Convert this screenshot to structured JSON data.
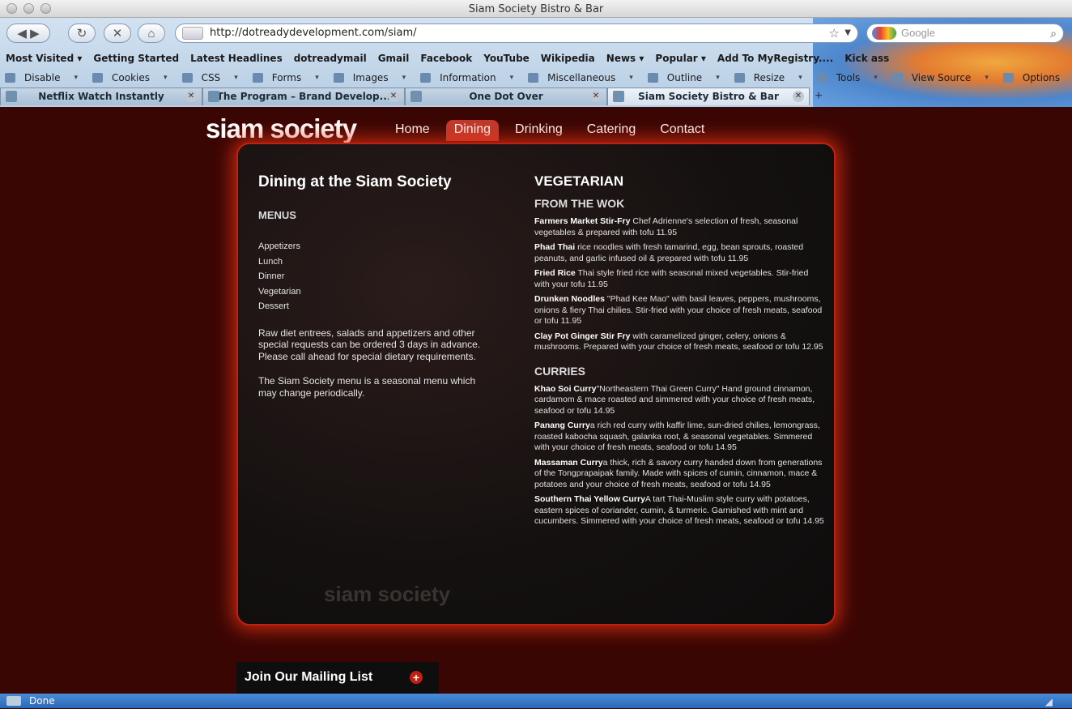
{
  "window": {
    "title": "Siam Society Bistro & Bar"
  },
  "navbar": {
    "url": "http://dotreadydevelopment.com/siam/",
    "search_placeholder": "Google"
  },
  "bookmarks": [
    "Most Visited ▾",
    "Getting Started",
    "Latest Headlines",
    "dotreadymail",
    "Gmail",
    "Facebook",
    "YouTube",
    "Wikipedia",
    "News ▾",
    "Popular ▾",
    "Add To MyRegistry....",
    "Kick ass"
  ],
  "devbar": [
    "Disable",
    "Cookies",
    "CSS",
    "Forms",
    "Images",
    "Information",
    "Miscellaneous",
    "Outline",
    "Resize",
    "Tools",
    "View Source",
    "Options"
  ],
  "tabs": [
    {
      "label": "Netflix Watch Instantly",
      "active": false
    },
    {
      "label": "The Program – Brand Develop...",
      "active": false
    },
    {
      "label": "One Dot Over",
      "active": false
    },
    {
      "label": "Siam Society Bistro & Bar",
      "active": true
    }
  ],
  "site": {
    "logo": "siam society",
    "nav": [
      "Home",
      "Dining",
      "Drinking",
      "Catering",
      "Contact"
    ],
    "active_nav": "Dining",
    "watermark": "siam society"
  },
  "left": {
    "heading": "Dining at the Siam Society",
    "menus_heading": "MENUS",
    "menus": [
      "Appetizers",
      "Lunch",
      "Dinner",
      "Vegetarian",
      "Dessert"
    ],
    "note1": "Raw diet entrees, salads and appetizers and other special requests can be ordered 3 days in advance. Please call ahead for special dietary requirements.",
    "note2": "The Siam Society menu is a seasonal menu which may change periodically."
  },
  "right": {
    "heading": "VEGETARIAN",
    "wok_heading": "FROM THE WOK",
    "wok": [
      {
        "name": "Farmers Market Stir-Fry",
        "desc": " Chef Adrienne's selection of fresh, seasonal vegetables & prepared with tofu 11.95"
      },
      {
        "name": "Phad Thai",
        "desc": " rice noodles with fresh tamarind, egg, bean sprouts, roasted peanuts, and garlic infused oil & prepared with tofu 11.95"
      },
      {
        "name": "Fried Rice",
        "desc": " Thai style fried rice with seasonal mixed vegetables. Stir-fried with your tofu 11.95"
      },
      {
        "name": "Drunken Noodles",
        "desc": " \"Phad Kee Mao\" with basil leaves, peppers, mushrooms, onions & fiery Thai chilies. Stir-fried with your choice of fresh meats, seafood or tofu 11.95"
      },
      {
        "name": "Clay Pot Ginger Stir Fry",
        "desc": " with caramelized ginger, celery, onions & mushrooms. Prepared with your choice of fresh meats, seafood or tofu 12.95"
      }
    ],
    "curries_heading": "CURRIES",
    "curries": [
      {
        "name": "Khao Soi Curry",
        "desc": "\"Northeastern Thai Green Curry\" Hand ground cinnamon, cardamom & mace roasted and simmered with your choice of fresh meats, seafood or tofu 14.95"
      },
      {
        "name": "Panang Curry",
        "desc": "a rich red curry with kaffir lime, sun-dried chilies, lemongrass, roasted kabocha squash, galanka root, & seasonal vegetables. Simmered with your choice of fresh meats, seafood or tofu 14.95"
      },
      {
        "name": "Massaman Curry",
        "desc": "a thick, rich & savory curry handed down from generations of the Tongprapaipak family. Made with spices of cumin, cinnamon, mace & potatoes and your choice of fresh meats, seafood or tofu 14.95"
      },
      {
        "name": "Southern Thai Yellow Curry",
        "desc": "A tart Thai-Muslim style curry with potatoes, eastern spices of coriander, cumin, & turmeric. Garnished with mint and cucumbers. Simmered with your choice of fresh meats, seafood or tofu 14.95"
      }
    ]
  },
  "mailing": {
    "label": "Join Our Mailing List",
    "plus": "+"
  },
  "status": {
    "text": "Done"
  }
}
